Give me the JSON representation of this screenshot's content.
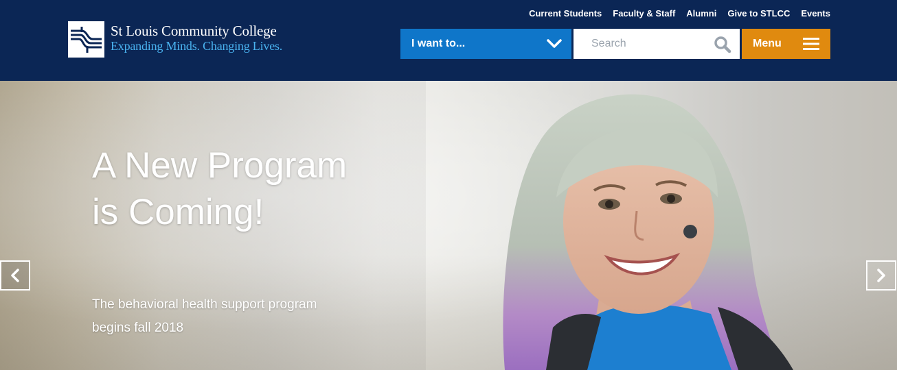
{
  "header": {
    "logo": {
      "name": "St Louis Community College",
      "tagline": "Expanding Minds. Changing Lives."
    },
    "utility_links": [
      "Current Students",
      "Faculty & Staff",
      "Alumni",
      "Give to STLCC",
      "Events"
    ],
    "i_want": {
      "label": "I want to...",
      "icon": "chevron-down-icon"
    },
    "search": {
      "placeholder": "Search",
      "icon": "search-icon"
    },
    "menu": {
      "label": "Menu",
      "icon": "hamburger-icon"
    }
  },
  "hero": {
    "title": "A New Program is Coming!",
    "subtitle": "The behavioral health support program begins fall 2018",
    "prev_icon": "chevron-left-icon",
    "next_icon": "chevron-right-icon"
  },
  "colors": {
    "header_bg": "#0b2655",
    "iwant_bg": "#0f76c9",
    "menu_bg": "#e08a0f",
    "tagline": "#4ab3f0"
  }
}
